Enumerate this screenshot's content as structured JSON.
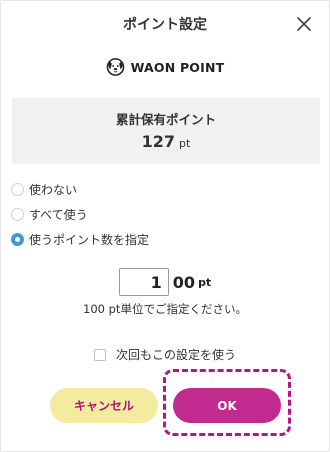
{
  "dialog": {
    "title": "ポイント設定",
    "close_icon": "close-icon"
  },
  "brand": {
    "logo_icon": "waon-dog-icon",
    "name": "WAON POINT"
  },
  "balance": {
    "label": "累計保有ポイント",
    "value": "127",
    "unit": "pt"
  },
  "options": [
    {
      "label": "使わない",
      "selected": false
    },
    {
      "label": "すべて使う",
      "selected": false
    },
    {
      "label": "使うポイント数を指定",
      "selected": true
    }
  ],
  "point_input": {
    "value": "1",
    "suffix": "00",
    "unit": "pt",
    "hint": "100 pt単位でご指定ください。"
  },
  "remember": {
    "label": "次回もこの設定を使う",
    "checked": false
  },
  "buttons": {
    "cancel": "キャンセル",
    "ok": "OK"
  },
  "colors": {
    "accent": "#c32a8f",
    "cancel_bg": "#f2eba0",
    "radio_selected": "#3c9bd6",
    "highlight": "#b01785"
  }
}
